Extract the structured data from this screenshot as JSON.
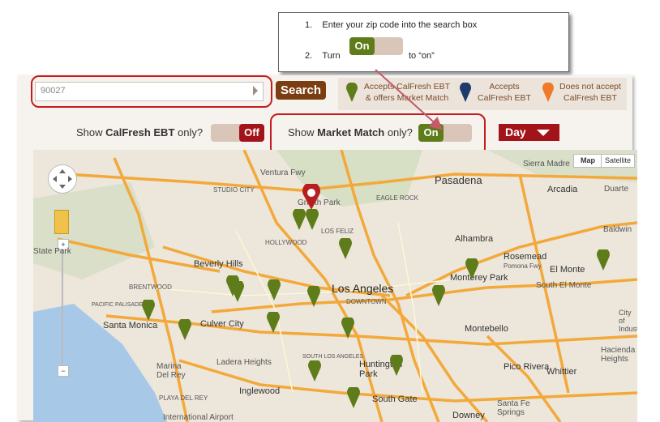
{
  "callout": {
    "step1_num": "1.",
    "step1_text": "Enter your zip code into the search box",
    "step2_num": "2.",
    "step2_pre": "Turn",
    "step2_toggle": "On",
    "step2_post": "to “on”"
  },
  "search": {
    "value": "90027",
    "button_label": "Search"
  },
  "legend": {
    "item1_line1": "Accepts CalFresh EBT",
    "item1_line2": "& offers Market Match",
    "item2_line1": "Accepts",
    "item2_line2": "CalFresh EBT",
    "item3_line1": "Does not accept",
    "item3_line2": "CalFresh EBT"
  },
  "filters": {
    "calfresh_pre": "Show ",
    "calfresh_bold": "CalFresh EBT",
    "calfresh_post": " only?",
    "calfresh_toggle": "Off",
    "market_pre": "Show ",
    "market_bold": "Market Match",
    "market_post": " only?",
    "market_toggle": "On",
    "day_label": "Day"
  },
  "map": {
    "map_button": "Map",
    "satellite_button": "Satellite",
    "zoom_in": "+",
    "zoom_out": "−",
    "labels": {
      "pasadena": "Pasadena",
      "sierra_madre": "Sierra Madre",
      "arcadia": "Arcadia",
      "duarte": "Duarte",
      "alhambra": "Alhambra",
      "rosemead": "Rosemead",
      "el_monte": "El Monte",
      "baldwin": "Baldwin",
      "monterey_park": "Monterey Park",
      "south_el_monte": "South El Monte",
      "beverly_hills": "Beverly Hills",
      "los_angeles": "Los Angeles",
      "santa_monica": "Santa Monica",
      "culver_city": "Culver City",
      "montebello": "Montebello",
      "ladera_heights": "Ladera Heights",
      "huntington_park": "Huntington Park",
      "pico_rivera": "Pico Rivera",
      "whittier": "Whittier",
      "hacienda": "Hacienda Heights",
      "marina": "Marina Del Rey",
      "inglewood": "Inglewood",
      "south_gate": "South Gate",
      "santa_fe": "Santa Fe Springs",
      "downey": "Downey",
      "lax": "International Airport",
      "playa": "PLAYA DEL REY",
      "hollywood": "HOLLYWOOD",
      "downtown": "DOWNTOWN",
      "south_la": "SOUTH LOS ANGELES",
      "studio_city": "STUDIO CITY",
      "brentwood": "BRENTWOOD",
      "pacific_pal": "PACIFIC PALISADES",
      "state_park": "State Park",
      "los_feliz": "LOS FELIZ",
      "eagle_rock": "EAGLE ROCK",
      "freeway": "Ventura Fwy",
      "griffith": "Griffith Park",
      "pomona_fwy": "Pomona Fwy",
      "city_industry": "City of Industry"
    }
  },
  "colors": {
    "accent_red": "#a3141a",
    "search_brown": "#7a3e12",
    "pin_green": "#5e7c19",
    "pin_navy": "#1f3b6b",
    "pin_orange": "#f07a2a",
    "ocean_blue": "#a8c8e8",
    "highway_orange": "#f3a93a"
  }
}
